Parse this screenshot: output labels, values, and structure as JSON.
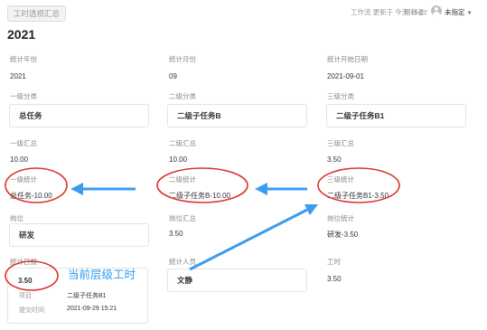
{
  "header": {
    "tag": "工时透视汇总",
    "status": "工作流 更新于  今天 15:22",
    "owner_label": "拥有者:",
    "owner_value": "未指定"
  },
  "title": "2021",
  "fields": {
    "stat_year": {
      "label": "统计年份",
      "value": "2021"
    },
    "stat_month": {
      "label": "统计月份",
      "value": "09"
    },
    "stat_start": {
      "label": "统计开始日期",
      "value": "2021-09-01"
    },
    "cat1": {
      "label": "一级分类",
      "value": "总任务"
    },
    "cat2": {
      "label": "二级分类",
      "value": "二级子任务B"
    },
    "cat3": {
      "label": "三级分类",
      "value": "二级子任务B1"
    },
    "sum1": {
      "label": "一级汇总",
      "value": "10.00"
    },
    "sum2": {
      "label": "二级汇总",
      "value": "10.00"
    },
    "sum3": {
      "label": "三级汇总",
      "value": "3.50"
    },
    "stat1": {
      "label": "一级统计",
      "value": "总任务-10.00"
    },
    "stat2": {
      "label": "二级统计",
      "value": "二级子任务B-10.00"
    },
    "stat3": {
      "label": "三级统计",
      "value": "二级子任务B1-3.50"
    },
    "position": {
      "label": "岗位",
      "value": "研发"
    },
    "position_sum": {
      "label": "岗位汇总",
      "value": "3.50"
    },
    "position_stat": {
      "label": "岗位统计",
      "value": "研发-3.50"
    },
    "daily_report": {
      "label": "统计日报",
      "value": "3.50"
    },
    "member": {
      "label": "统计人员",
      "value": "文静"
    },
    "hours": {
      "label": "工时",
      "value": "3.50"
    }
  },
  "report_card": {
    "item_label": "项目",
    "item_value": "二级子任务B1",
    "time_label": "提交时间",
    "time_value": "2021-09-29 15:21"
  },
  "annotation": {
    "text": "当前层级工时",
    "color": "#2f9bef",
    "ellipse_color": "#d9342b"
  }
}
